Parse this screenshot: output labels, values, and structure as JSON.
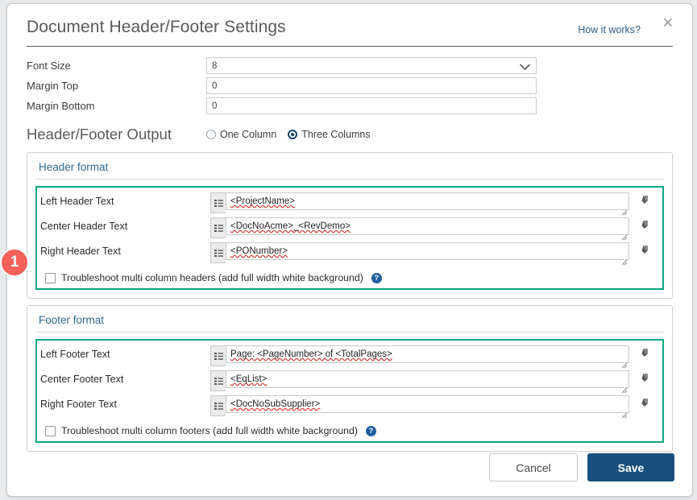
{
  "dialog": {
    "title": "Document Header/Footer Settings",
    "how_it_works": "How it works?",
    "close_icon": "close-icon"
  },
  "settings": [
    {
      "label": "Font Size",
      "value": "8",
      "type": "select"
    },
    {
      "label": "Margin Top",
      "value": "0",
      "type": "text"
    },
    {
      "label": "Margin Bottom",
      "value": "0",
      "type": "text"
    }
  ],
  "output": {
    "title": "Header/Footer Output",
    "options": [
      {
        "label": "One Column",
        "selected": false
      },
      {
        "label": "Three Columns",
        "selected": true
      }
    ]
  },
  "header_panel": {
    "title": "Header format",
    "rows": [
      {
        "label": "Left Header Text",
        "value": "<ProjectName>",
        "prefix_icon": "list-icon",
        "clear_icon": "eraser-icon"
      },
      {
        "label": "Center Header Text",
        "value": "<DocNoAcme>_<RevDemo>",
        "prefix_icon": "list-icon",
        "clear_icon": "eraser-icon"
      },
      {
        "label": "Right Header Text",
        "value": "<PONumber>",
        "prefix_icon": "list-icon",
        "clear_icon": "eraser-icon"
      }
    ],
    "checkbox": {
      "label": "Troubleshoot multi column headers (add full width white background)",
      "checked": false,
      "help_icon": "help-icon",
      "help_glyph": "?"
    }
  },
  "footer_panel": {
    "title": "Footer format",
    "rows": [
      {
        "label": "Left Footer Text",
        "value": "Page: <PageNumber> of <TotalPages>",
        "prefix_icon": "list-icon",
        "clear_icon": "eraser-icon"
      },
      {
        "label": "Center Footer Text",
        "value": "<EqList>",
        "prefix_icon": "list-icon",
        "clear_icon": "eraser-icon"
      },
      {
        "label": "Right Footer Text",
        "value": "<DocNoSubSupplier>",
        "prefix_icon": "list-icon",
        "clear_icon": "eraser-icon"
      }
    ],
    "checkbox": {
      "label": "Troubleshoot multi column footers (add full width white background)",
      "checked": false,
      "help_icon": "help-icon",
      "help_glyph": "?"
    }
  },
  "annotation_badge": {
    "number": "1"
  },
  "buttons": {
    "cancel": "Cancel",
    "save": "Save"
  },
  "colors": {
    "teal_highlight": "#0aa884",
    "badge_red": "#f4605a",
    "save_blue": "#17507c",
    "panel_title_blue": "#2c6a93",
    "link_blue": "#2c5d87"
  }
}
